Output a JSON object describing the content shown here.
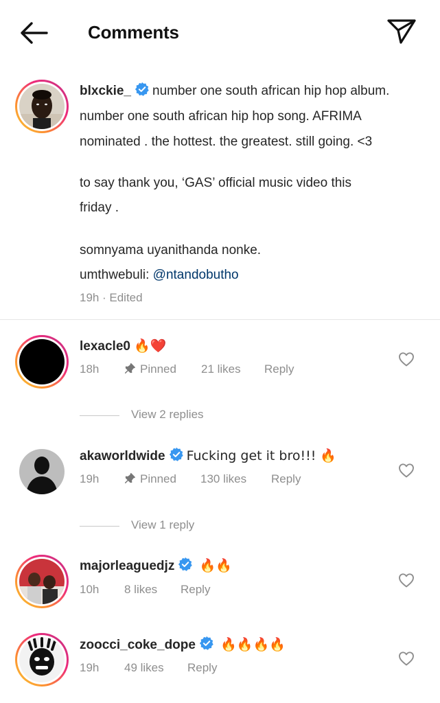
{
  "header": {
    "title": "Comments"
  },
  "caption": {
    "username": "blxckie_",
    "line1": "number one south african hip hop album.",
    "line2": "number one south african hip hop song. AFRIMA",
    "line3": "nominated . the hottest. the greatest. still going. <3",
    "line4": "to say thank you, ‘GAS’ official music video this",
    "line5": "friday .",
    "line6": "somnyama uyanithanda nonke.",
    "line7_prefix": "umthwebuli: ",
    "line7_mention": "@ntandobutho",
    "time": "19h",
    "edited": "· Edited"
  },
  "comments": [
    {
      "username": "lexacle0",
      "text": "🔥❤️",
      "time": "18h",
      "pinned": "Pinned",
      "likes": "21 likes",
      "reply": "Reply",
      "view_replies": "View 2 replies"
    },
    {
      "username": "akaworldwide",
      "text": "Fucking get it bro!!! 🔥",
      "time": "19h",
      "pinned": "Pinned",
      "likes": "130 likes",
      "reply": "Reply",
      "view_replies": "View 1 reply"
    },
    {
      "username": "majorleaguedjz",
      "text": "🔥🔥",
      "time": "10h",
      "likes": "8 likes",
      "reply": "Reply"
    },
    {
      "username": "zoocci_coke_dope",
      "text": "🔥🔥🔥🔥",
      "time": "19h",
      "likes": "49 likes",
      "reply": "Reply"
    }
  ],
  "icons": {
    "back": "arrow-left-icon",
    "share": "paper-plane-icon",
    "verified": "verified-badge-icon",
    "pin": "pin-icon",
    "heart": "heart-outline-icon"
  },
  "colors": {
    "verified": "#3897f0",
    "mention": "#00376b",
    "secondary_text": "#8e8e8e",
    "fire": "#ff7a00",
    "heart_red": "#e0151b"
  }
}
